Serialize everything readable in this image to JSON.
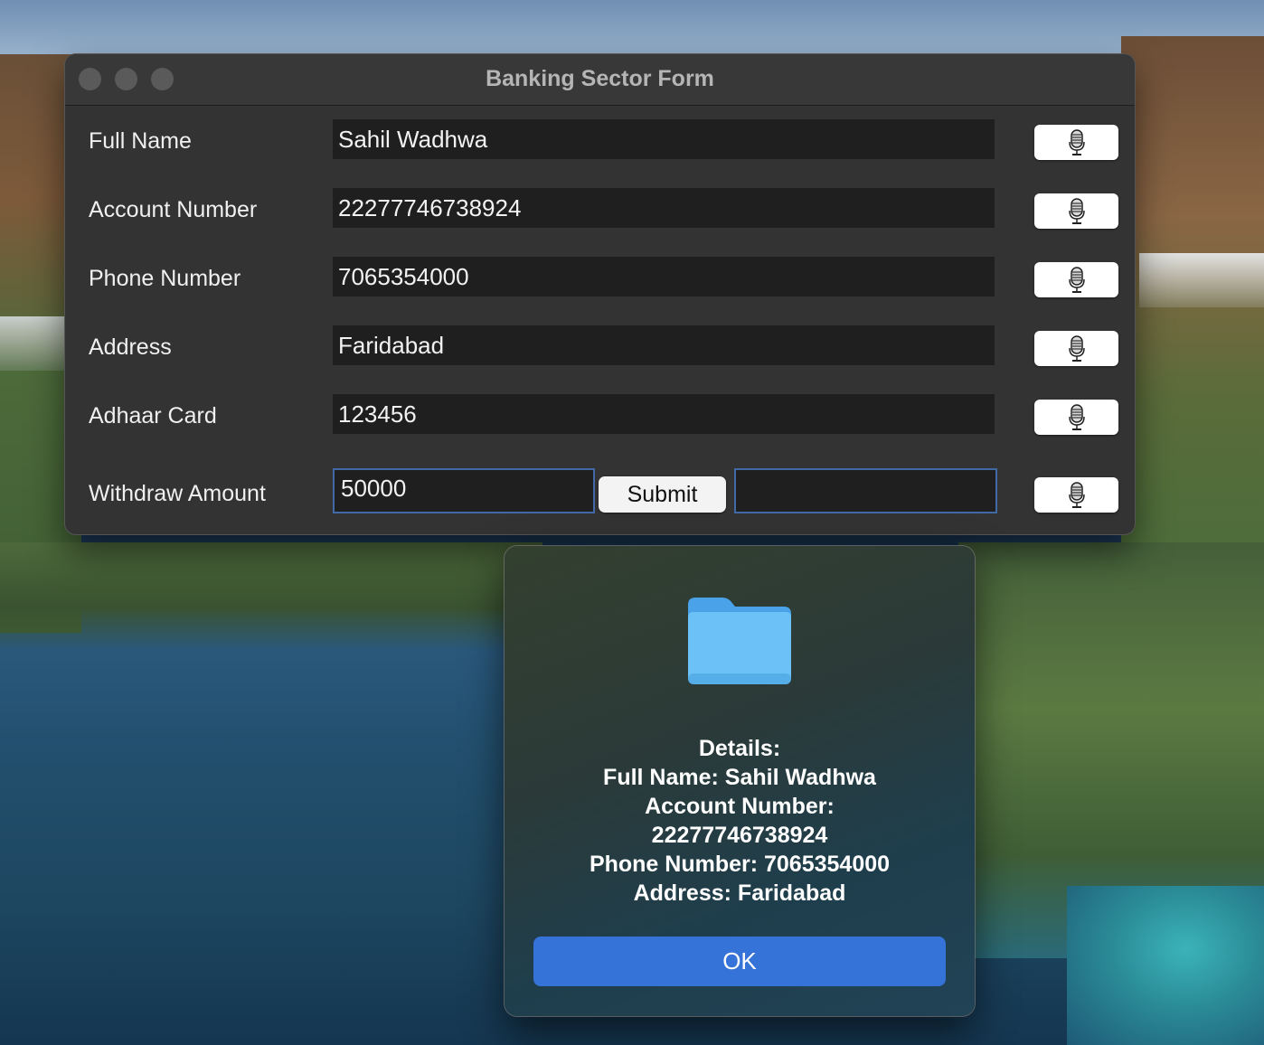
{
  "window": {
    "title": "Banking Sector Form"
  },
  "form": {
    "rows": [
      {
        "label": "Full Name",
        "value": "Sahil Wadhwa"
      },
      {
        "label": "Account Number",
        "value": "22277746738924"
      },
      {
        "label": "Phone Number",
        "value": "7065354000"
      },
      {
        "label": "Address",
        "value": "Faridabad"
      },
      {
        "label": "Adhaar Card",
        "value": "123456"
      }
    ],
    "withdraw": {
      "label": "Withdraw Amount",
      "value": "50000",
      "submit_label": "Submit",
      "extra_value": ""
    },
    "mic_icon": "microphone-icon"
  },
  "dialog": {
    "icon": "folder-icon",
    "lines": [
      "Details:",
      "Full Name: Sahil Wadhwa",
      "Account Number:",
      "22277746738924",
      "Phone Number: 7065354000",
      "Address: Faridabad"
    ],
    "ok_label": "OK"
  },
  "colors": {
    "accent": "#3573d8",
    "focus_ring": "#3f6aa6",
    "window_bg": "#333333",
    "field_bg": "#1f1f1f"
  }
}
